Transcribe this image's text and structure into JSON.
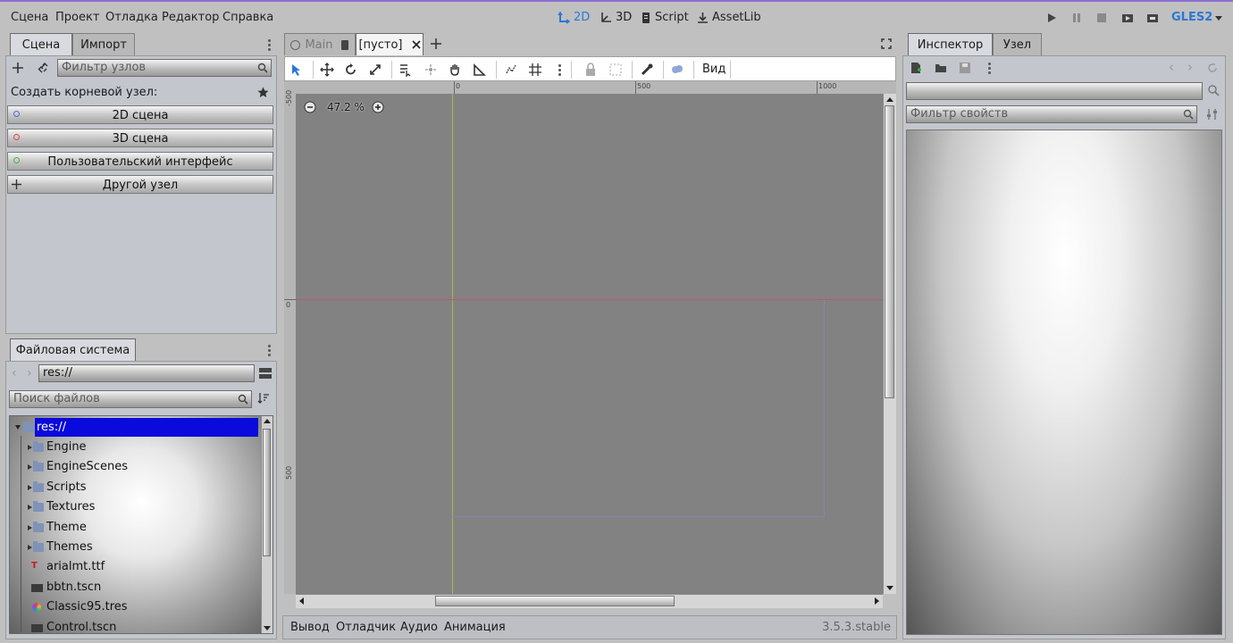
{
  "menu": [
    "Сцена",
    "Проект",
    "Отладка",
    "Редактор",
    "Справка"
  ],
  "workspaces": [
    {
      "label": "2D",
      "icon": "2d-move-icon",
      "active": true
    },
    {
      "label": "3D",
      "icon": "3d-move-icon",
      "active": false
    },
    {
      "label": "Script",
      "icon": "script-icon",
      "active": false
    },
    {
      "label": "AssetLib",
      "icon": "download-icon",
      "active": false
    }
  ],
  "renderer": "GLES2",
  "accent": "#2a78d6",
  "scene_dock": {
    "tabs": [
      "Сцена",
      "Импорт"
    ],
    "filter_placeholder": "Фильтр узлов",
    "create_root_label": "Создать корневой узел:",
    "root_buttons": [
      {
        "label": "2D сцена",
        "icon": "node2d-icon",
        "color": "#4a6fd8"
      },
      {
        "label": "3D сцена",
        "icon": "spatial-icon",
        "color": "#d84a4a"
      },
      {
        "label": "Пользовательский интерфейс",
        "icon": "control-icon",
        "color": "#4ab04a"
      },
      {
        "label": "Другой узел",
        "icon": "plus-icon",
        "color": "#333333"
      }
    ]
  },
  "filesystem": {
    "tab": "Файловая система",
    "path": "res://",
    "search_placeholder": "Поиск файлов",
    "items": [
      {
        "name": "res://",
        "type": "root-folder",
        "selected": true
      },
      {
        "name": "Engine",
        "type": "folder"
      },
      {
        "name": "EngineScenes",
        "type": "folder"
      },
      {
        "name": "Scripts",
        "type": "folder"
      },
      {
        "name": "Textures",
        "type": "folder"
      },
      {
        "name": "Theme",
        "type": "folder"
      },
      {
        "name": "Themes",
        "type": "folder"
      },
      {
        "name": "arialmt.ttf",
        "type": "font"
      },
      {
        "name": "bbtn.tscn",
        "type": "scene"
      },
      {
        "name": "Classic95.tres",
        "type": "theme"
      },
      {
        "name": "Control.tscn",
        "type": "scene"
      }
    ]
  },
  "editor_tabs": [
    {
      "label": "Main",
      "active": false
    },
    {
      "label": "[пусто]",
      "active": true
    }
  ],
  "viewport": {
    "zoom": "47.2 %",
    "view_menu": "Вид",
    "ruler_top": [
      "0",
      "500",
      "1000"
    ],
    "ruler_left": [
      "-500",
      "0",
      "500"
    ]
  },
  "bottom_panel": {
    "tabs": [
      "Вывод",
      "Отладчик",
      "Аудио",
      "Анимация"
    ],
    "version": "3.5.3.stable"
  },
  "inspector": {
    "tabs": [
      "Инспектор",
      "Узел"
    ],
    "filter_placeholder": "Фильтр свойств"
  }
}
